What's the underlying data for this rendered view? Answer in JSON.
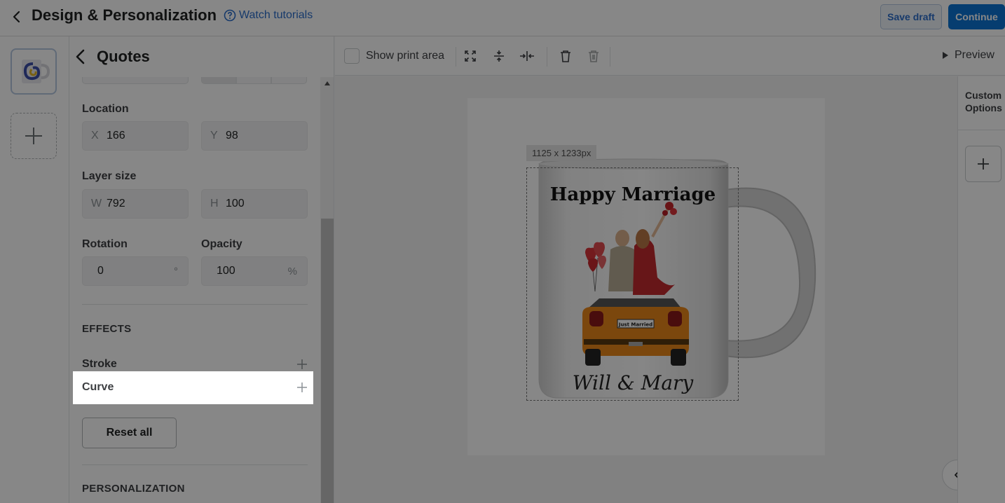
{
  "header": {
    "title": "Design & Personalization",
    "watch_tutorials": "Watch tutorials",
    "save_draft": "Save draft",
    "continue": "Continue"
  },
  "panel": {
    "title": "Quotes",
    "location": {
      "label": "Location",
      "x_prefix": "X",
      "x_value": "166",
      "y_prefix": "Y",
      "y_value": "98"
    },
    "layer_size": {
      "label": "Layer size",
      "w_prefix": "W",
      "w_value": "792",
      "h_prefix": "H",
      "h_value": "100"
    },
    "rotation": {
      "label": "Rotation",
      "value": "0",
      "suffix": "°"
    },
    "opacity": {
      "label": "Opacity",
      "value": "100",
      "suffix": "%"
    },
    "effects_heading": "EFFECTS",
    "effects": [
      {
        "label": "Stroke"
      },
      {
        "label": "Curve"
      }
    ],
    "reset_all": "Reset all",
    "personalization_heading": "PERSONALIZATION"
  },
  "toolbar": {
    "show_print_area": "Show print area",
    "preview": "Preview",
    "icons": [
      "fit-screen-icon",
      "align-center-vertical-icon",
      "align-center-horizontal-icon",
      "delete-icon",
      "delete-all-icon"
    ]
  },
  "canvas": {
    "dimension_label": "1125 x 1233px",
    "mug_text_top": "Happy Marriage",
    "mug_text_bottom": "Will & Mary",
    "plate_text": "Just Married"
  },
  "right_panel": {
    "label": "Custom Options"
  },
  "colors": {
    "accent": "#0d74d3",
    "link": "#2c6ecb",
    "car": "#e8861a"
  }
}
